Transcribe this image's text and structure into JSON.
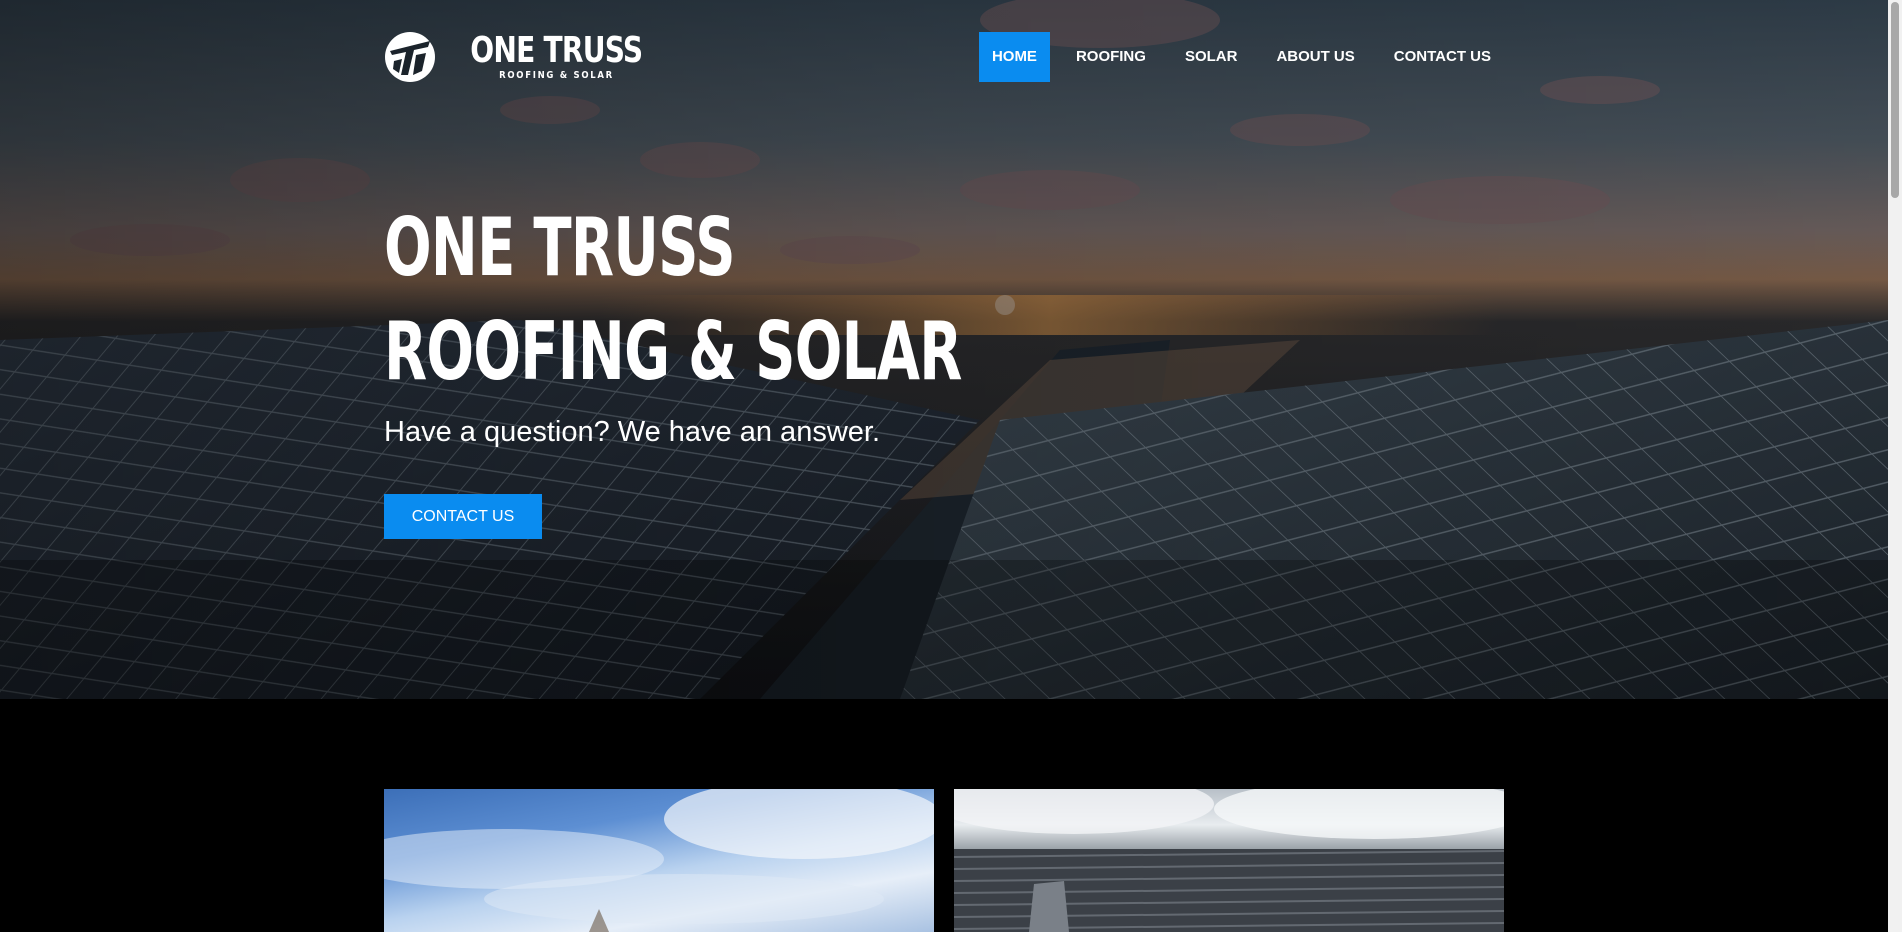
{
  "brand": {
    "name": "ONE TRUSS",
    "tagline": "ROOFING & SOLAR"
  },
  "nav": {
    "items": [
      {
        "label": "HOME",
        "active": true
      },
      {
        "label": "ROOFING",
        "active": false
      },
      {
        "label": "SOLAR",
        "active": false
      },
      {
        "label": "ABOUT US",
        "active": false
      },
      {
        "label": "CONTACT US",
        "active": false
      }
    ]
  },
  "hero": {
    "title_line1": "ONE TRUSS",
    "title_line2": "ROOFING & SOLAR",
    "subtitle": "Have a question? We have an answer.",
    "cta_label": "CONTACT US"
  },
  "colors": {
    "accent": "#0a8cf0",
    "background": "#000000",
    "text": "#ffffff"
  },
  "icons": {
    "logo": "one-truss-logo-icon"
  }
}
